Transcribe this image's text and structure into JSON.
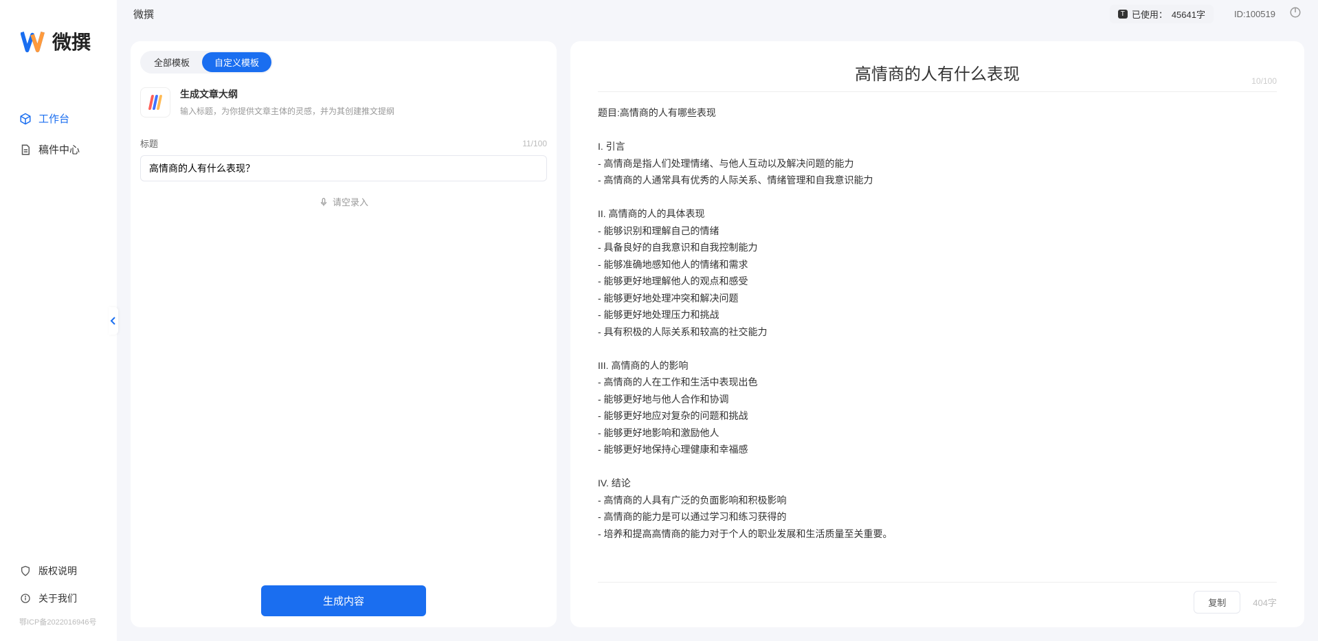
{
  "brand": {
    "name": "微撰"
  },
  "sidebar": {
    "items": [
      {
        "label": "工作台",
        "active": true
      },
      {
        "label": "稿件中心",
        "active": false
      }
    ],
    "bottom": [
      {
        "label": "版权说明"
      },
      {
        "label": "关于我们"
      }
    ],
    "icp": "鄂ICP备2022016946号"
  },
  "topbar": {
    "title": "微撰",
    "usage_prefix": "已使用：",
    "usage_value": "45641字",
    "id_prefix": "ID:",
    "id_value": "100519"
  },
  "tabs": {
    "all": "全部模板",
    "custom": "自定义模板"
  },
  "template": {
    "title": "生成文章大纲",
    "desc": "输入标题，为你提供文章主体的灵感，并为其创建推文提纲"
  },
  "form": {
    "label_title": "标题",
    "count_hint": "11/100",
    "title_value": "高情商的人有什么表现？",
    "voice_hint": "请空录入",
    "generate": "生成内容"
  },
  "output": {
    "title": "高情商的人有什么表现",
    "title_count": "10/100",
    "body": "题目:高情商的人有哪些表现\n\nI. 引言\n- 高情商是指人们处理情绪、与他人互动以及解决问题的能力\n- 高情商的人通常具有优秀的人际关系、情绪管理和自我意识能力\n\nII. 高情商的人的具体表现\n- 能够识别和理解自己的情绪\n- 具备良好的自我意识和自我控制能力\n- 能够准确地感知他人的情绪和需求\n- 能够更好地理解他人的观点和感受\n- 能够更好地处理冲突和解决问题\n- 能够更好地处理压力和挑战\n- 具有积极的人际关系和较高的社交能力\n\nIII. 高情商的人的影响\n- 高情商的人在工作和生活中表现出色\n- 能够更好地与他人合作和协调\n- 能够更好地应对复杂的问题和挑战\n- 能够更好地影响和激励他人\n- 能够更好地保持心理健康和幸福感\n\nIV. 结论\n- 高情商的人具有广泛的负面影响和积极影响\n- 高情商的能力是可以通过学习和练习获得的\n- 培养和提高高情商的能力对于个人的职业发展和生活质量至关重要。",
    "copy": "复制",
    "word_count": "404字"
  },
  "colors": {
    "accent": "#1a6ef0"
  }
}
